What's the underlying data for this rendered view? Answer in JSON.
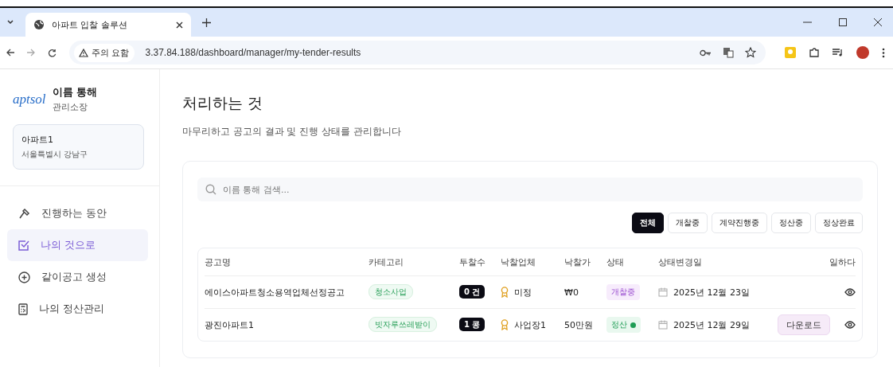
{
  "browser": {
    "tab_title": "아파트 입찰 솔루션",
    "security_label": "주의 요함",
    "url": "3.37.84.188/dashboard/manager/my-tender-results"
  },
  "sidebar": {
    "logo": "aptsol",
    "user_name": "이름 통해",
    "user_role": "관리소장",
    "apartment": {
      "name": "아파트1",
      "address": "서울특별시 강남구"
    },
    "items": [
      {
        "label": "진행하는 동안",
        "kind": "hammer",
        "selected": false
      },
      {
        "label": "나의 것으로",
        "kind": "check",
        "selected": true
      },
      {
        "label": "같이공고 생성",
        "kind": "plus",
        "selected": false
      },
      {
        "label": "나의 정산관리",
        "kind": "calc",
        "selected": false
      }
    ]
  },
  "page": {
    "title": "처리하는 것",
    "subtitle": "마무리하고 공고의 결과 및 진행 상태를 관리합니다"
  },
  "search": {
    "placeholder": "이름 통해 검색..."
  },
  "filters": [
    {
      "label": "전체",
      "selected": true
    },
    {
      "label": "개찰중",
      "selected": false
    },
    {
      "label": "계약진행중",
      "selected": false
    },
    {
      "label": "정산중",
      "selected": false
    },
    {
      "label": "정상완료",
      "selected": false
    }
  ],
  "table": {
    "columns": [
      "공고명",
      "카테고리",
      "투찰수",
      "낙찰업체",
      "낙찰가",
      "상태",
      "상태변경일",
      "일하다"
    ],
    "rows": [
      {
        "name": "에이스아파트청소용역업체선정공고",
        "category": "청소사업",
        "bids": "0 건",
        "winner": "미정",
        "price": "₩0",
        "status": {
          "label": "개찰중",
          "kind": "opening",
          "dot": false
        },
        "date": "2025년 12월 23일"
      },
      {
        "name": "광진아파트1",
        "category": "빗자루쓰레받이",
        "bids": "1 콩",
        "winner": "사업장1",
        "price": "50만원",
        "status": {
          "label": "정산",
          "kind": "settling",
          "dot": true
        },
        "date": "2025년 12월 29일",
        "action": "다운로드"
      }
    ]
  }
}
